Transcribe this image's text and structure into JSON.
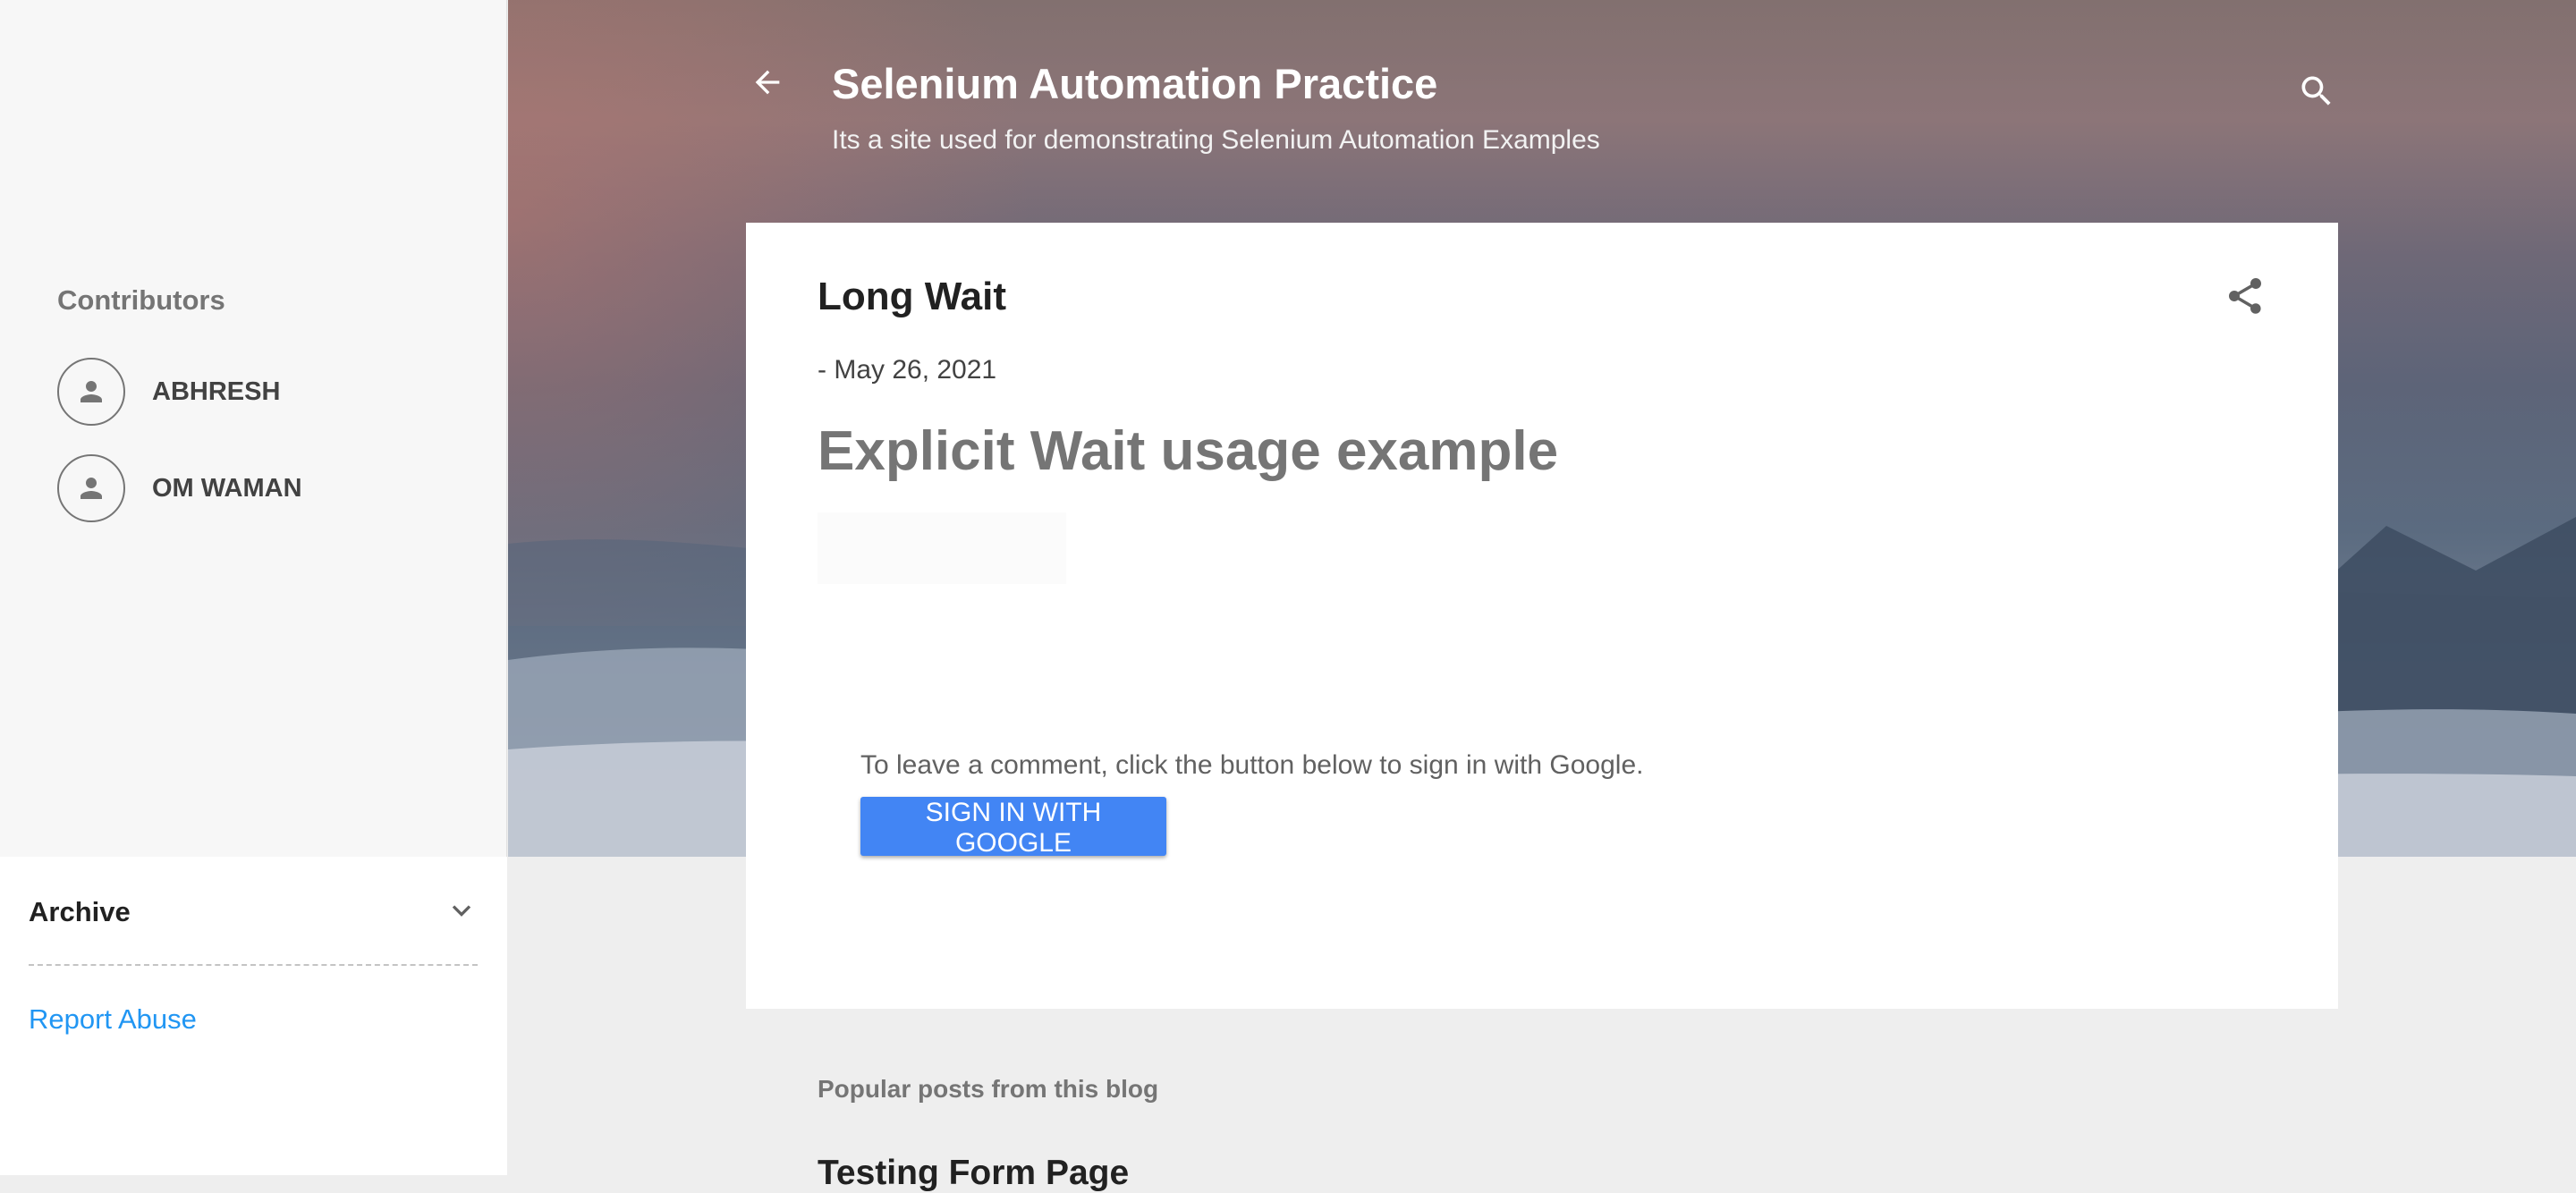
{
  "header": {
    "title": "Selenium Automation Practice",
    "description": "Its a site used for demonstrating Selenium Automation Examples"
  },
  "sidebar": {
    "contributors_title": "Contributors",
    "contributors": [
      {
        "name": "ABHRESH"
      },
      {
        "name": "OM WAMAN"
      }
    ],
    "archive_label": "Archive",
    "report_abuse_label": "Report Abuse"
  },
  "post": {
    "title": "Long Wait",
    "date": "- May 26, 2021",
    "heading": "Explicit Wait usage example",
    "comment_prompt": "To leave a comment, click the button below to sign in with Google.",
    "sign_in_button": "SIGN IN WITH GOOGLE"
  },
  "popular": {
    "title": "Popular posts from this blog",
    "first_post_title": "Testing Form Page"
  },
  "colors": {
    "accent_blue": "#4285f4",
    "link_blue": "#2196f3"
  },
  "icons": [
    "back-arrow-icon",
    "search-icon",
    "share-icon",
    "person-icon",
    "chevron-down-icon"
  ]
}
